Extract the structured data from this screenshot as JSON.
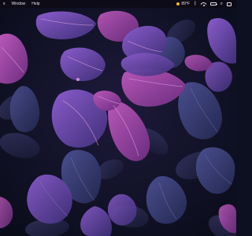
{
  "menubar": {
    "app_menu": "s",
    "items": [
      "Window",
      "Help"
    ],
    "status": {
      "weather": "89°F",
      "battery_level": 0.8
    }
  },
  "wallpaper": {
    "subject": "purple-leaves",
    "colors": {
      "background": "#0c1020",
      "leaf_bright": "#9a3fa8",
      "leaf_mid": "#5b3a8c",
      "leaf_dark": "#2a2e5c"
    }
  }
}
